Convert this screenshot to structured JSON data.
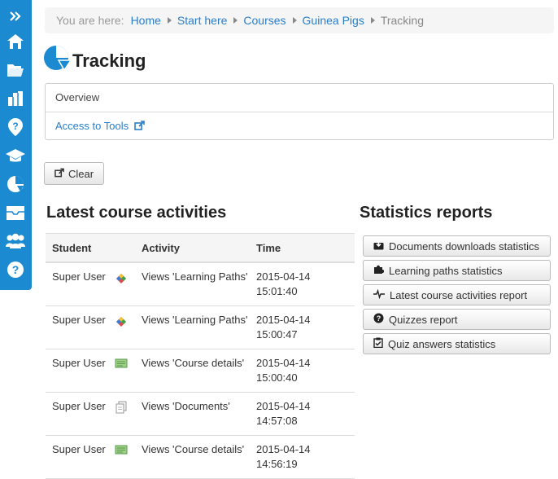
{
  "breadcrumb": {
    "prefix": "You are here:",
    "items": [
      "Home",
      "Start here",
      "Courses",
      "Guinea Pigs"
    ],
    "current": "Tracking"
  },
  "page": {
    "title": "Tracking"
  },
  "panel": {
    "overview": "Overview",
    "access_tools": "Access to Tools"
  },
  "clear_button": "Clear",
  "activities": {
    "title": "Latest course activities",
    "columns": [
      "Student",
      "Activity",
      "Time"
    ],
    "rows": [
      {
        "student": "Super User",
        "icon": "learning-path-icon",
        "activity": "Views 'Learning Paths'",
        "date": "2015-04-14",
        "time": "15:01:40"
      },
      {
        "student": "Super User",
        "icon": "learning-path-icon",
        "activity": "Views 'Learning Paths'",
        "date": "2015-04-14",
        "time": "15:00:47"
      },
      {
        "student": "Super User",
        "icon": "course-details-icon",
        "activity": "Views 'Course details'",
        "date": "2015-04-14",
        "time": "15:00:40"
      },
      {
        "student": "Super User",
        "icon": "documents-icon",
        "activity": "Views 'Documents'",
        "date": "2015-04-14",
        "time": "14:57:08"
      },
      {
        "student": "Super User",
        "icon": "course-details-icon",
        "activity": "Views 'Course details'",
        "date": "2015-04-14",
        "time": "14:56:19"
      }
    ]
  },
  "statistics": {
    "title": "Statistics reports",
    "buttons": [
      {
        "label": "Documents downloads statistics",
        "icon": "download-icon"
      },
      {
        "label": "Learning paths statistics",
        "icon": "puzzle-icon"
      },
      {
        "label": "Latest course activities report",
        "icon": "pulse-icon"
      },
      {
        "label": "Quizzes report",
        "icon": "question-circle-icon"
      },
      {
        "label": "Quiz answers statistics",
        "icon": "clipboard-check-icon"
      }
    ]
  },
  "colors": {
    "sidebar": "#1b8ad1",
    "link": "#2a7ec8",
    "title_icon": "#1b8ad1"
  }
}
